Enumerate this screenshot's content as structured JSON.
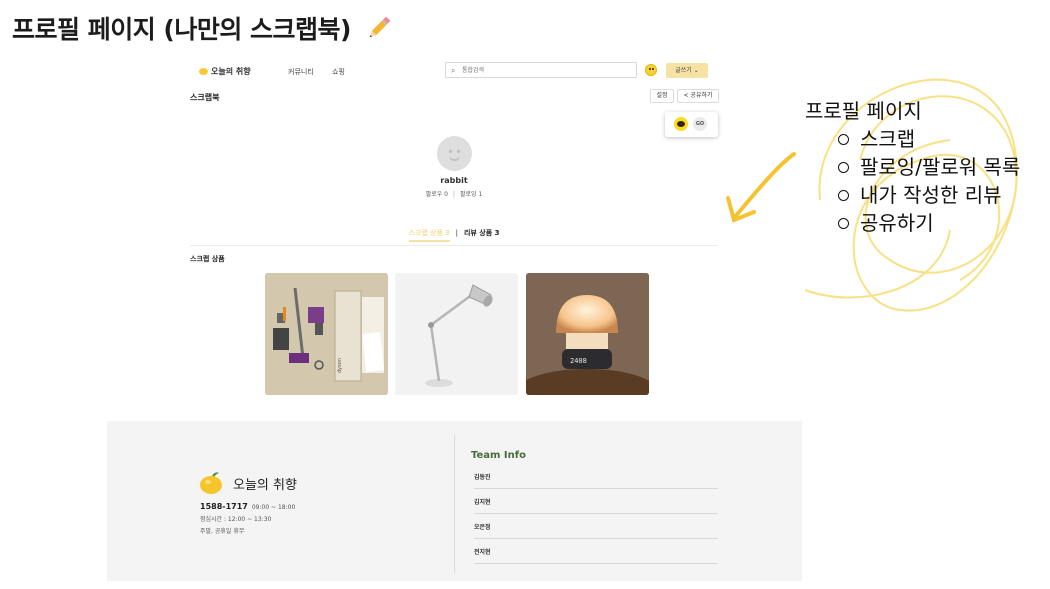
{
  "slide": {
    "title": "프로필 페이지 (나만의 스크랩북)"
  },
  "site": {
    "logo_text": "오늘의 취향",
    "nav": [
      "커뮤니티",
      "쇼핑"
    ],
    "search_placeholder": "통합검색",
    "write_button": "글쓰기 ⌄"
  },
  "profile": {
    "section_title": "스크랩북",
    "settings_button": "설정",
    "share_button": "공유하기",
    "go_label": "GO",
    "username": "rabbit",
    "followers": "팔로우 0",
    "following": "팔로잉 1",
    "tabs": [
      "스크랩 상품 3",
      "리뷰 상품 3"
    ],
    "scrap_goods_title": "스크랩 상품"
  },
  "products": [
    {
      "name": "dyson cordless vacuum set"
    },
    {
      "name": "desk lamp"
    },
    {
      "name": "mushroom mood lamp clock",
      "clock_text": "2408"
    }
  ],
  "footer": {
    "logo_text": "오늘의 취향",
    "phone": "1588-1717",
    "hours": "09:00 ~ 18:00",
    "lunch": "점심시간 : 12:00 ~ 13:30",
    "holiday": "주말, 공휴일 휴무",
    "team_title": "Team Info",
    "members": [
      "김동진",
      "김지현",
      "오은정",
      "전지현"
    ]
  },
  "annotation": {
    "heading": "프로필 페이지",
    "items": [
      "스크랩",
      "팔로잉/팔로워 목록",
      "내가 작성한 리뷰",
      "공유하기"
    ]
  },
  "colors": {
    "accent_yellow": "#f7e2a6",
    "tab_active": "#f3cf6d",
    "team_green": "#4a6a3d",
    "footer_bg": "#f4f4f4",
    "annotation_swirl": "#f7dc6f"
  }
}
